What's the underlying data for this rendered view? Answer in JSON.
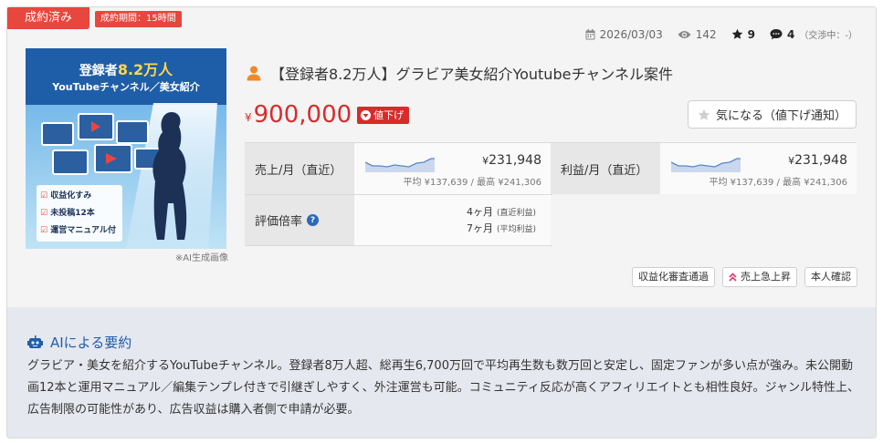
{
  "badges": {
    "status": "成約済み",
    "period": "成約期間：15時間"
  },
  "meta": {
    "date": "2026/03/03",
    "views": "142",
    "favorites": "9",
    "comments": "4",
    "comments_note": "（交渉中：-）"
  },
  "thumbnail": {
    "headline_prefix": "登録者",
    "headline_number": "8.2万人",
    "subline": "YouTubeチャンネル／美女紹介",
    "checks": [
      "収益化すみ",
      "未投稿12本",
      "運営マニュアル付"
    ],
    "caption": "※AI生成画像"
  },
  "listing": {
    "title": "【登録者8.2万人】グラビア美女紹介Youtubeチャンネル案件",
    "price_currency": "¥",
    "price": "900,000",
    "price_down_label": "値下げ",
    "watch_button": "気になる（値下げ通知）"
  },
  "metrics": {
    "sales_label": "売上/月（直近）",
    "sales_value_currency": "¥",
    "sales_value": "231,948",
    "sales_sub": "平均 ¥137,639 / 最高 ¥241,306",
    "profit_label": "利益/月（直近）",
    "profit_value_currency": "¥",
    "profit_value": "231,948",
    "profit_sub": "平均 ¥137,639 / 最高 ¥241,306",
    "multiple_label": "評価倍率",
    "multiple_recent": "4ヶ月",
    "multiple_recent_note": "(直近利益)",
    "multiple_avg": "7ヶ月",
    "multiple_avg_note": "(平均利益)"
  },
  "tags": [
    "収益化審査通過",
    "売上急上昇",
    "本人確認"
  ],
  "ai_summary": {
    "heading": "AIによる要約",
    "text": "グラビア・美女を紹介するYouTubeチャンネル。登録者8万人超、総再生6,700万回で平均再生数も数万回と安定し、固定ファンが多い点が強み。未公開動画12本と運用マニュアル／編集テンプレ付きで引継ぎしやすく、外注運営も可能。コミュニティ反応が高くアフィリエイトとも相性良好。ジャンル特性上、広告制限の可能性があり、広告収益は購入者側で申請が必要。"
  },
  "colors": {
    "accent_red": "#d92b2b",
    "ai_blue": "#1f5fa8",
    "spark_blue": "#5b87c7"
  }
}
